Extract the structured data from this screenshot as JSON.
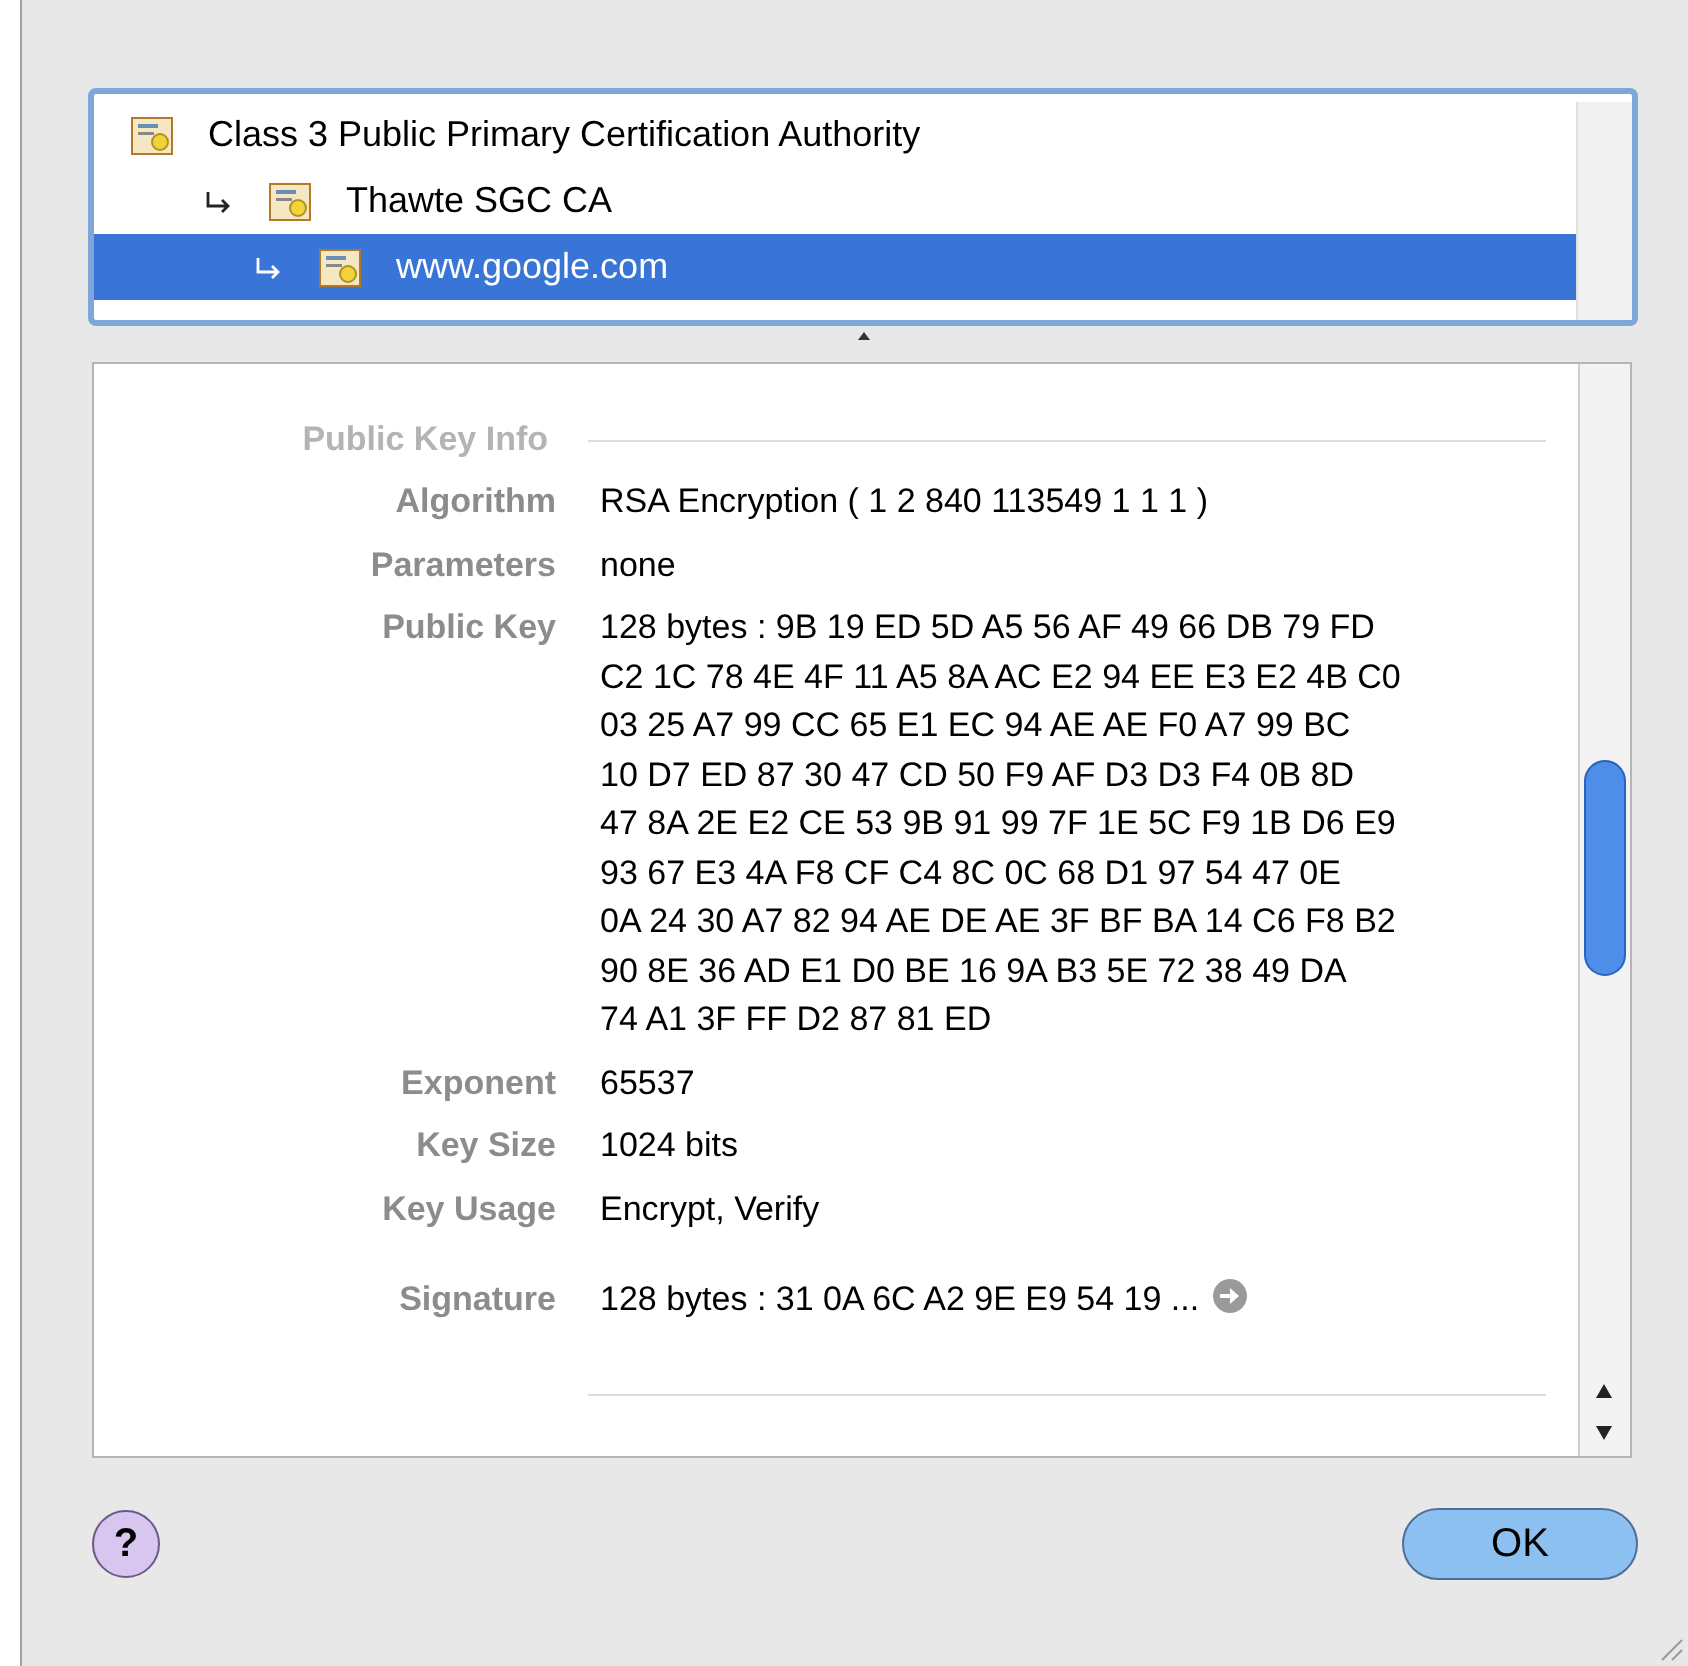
{
  "chain": [
    {
      "label": "Class 3 Public Primary Certification Authority",
      "selected": false,
      "children": [
        {
          "label": "Thawte SGC CA",
          "selected": false,
          "children": [
            {
              "label": "www.google.com",
              "selected": true
            }
          ]
        }
      ]
    }
  ],
  "details": {
    "section": "Public Key Info",
    "rows": [
      {
        "kind": "field",
        "label": "Algorithm",
        "lines": [
          "RSA Encryption ( 1 2 840 113549 1 1 1 )"
        ]
      },
      {
        "kind": "field",
        "label": "Parameters",
        "lines": [
          "none"
        ]
      },
      {
        "kind": "field",
        "label": "Public Key",
        "lines": [
          "128 bytes : 9B 19 ED 5D A5 56 AF 49 66 DB 79 FD",
          "C2 1C 78 4E 4F 11 A5 8A AC E2 94 EE E3 E2 4B C0",
          "03 25 A7 99 CC 65 E1 EC 94 AE AE F0 A7 99 BC",
          "10 D7 ED 87 30 47 CD 50 F9 AF D3 D3 F4 0B 8D",
          "47 8A 2E E2 CE 53 9B 91 99 7F 1E 5C F9 1B D6 E9",
          "93 67 E3 4A F8 CF C4 8C 0C 68 D1 97 54 47 0E",
          "0A 24 30 A7 82 94 AE DE AE 3F BF BA 14 C6 F8 B2",
          "90 8E 36 AD E1 D0 BE 16 9A B3 5E 72 38 49 DA",
          "74 A1 3F FF D2 87 81 ED"
        ]
      },
      {
        "kind": "field",
        "label": "Exponent",
        "lines": [
          "65537"
        ]
      },
      {
        "kind": "field",
        "label": "Key Size",
        "lines": [
          "1024 bits"
        ]
      },
      {
        "kind": "field",
        "label": "Key Usage",
        "lines": [
          "Encrypt, Verify"
        ]
      },
      {
        "kind": "expandable",
        "label": "Signature",
        "lines": [
          "128 bytes : 31 0A 6C A2 9E E9 54 19 ..."
        ]
      }
    ]
  },
  "help_button": "?",
  "ok_button": "OK"
}
